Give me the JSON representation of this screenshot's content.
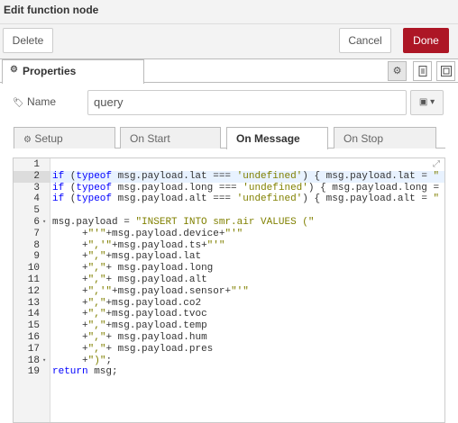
{
  "window": {
    "title": "Edit function node"
  },
  "toolbar": {
    "delete_label": "Delete",
    "cancel_label": "Cancel",
    "done_label": "Done",
    "done_color": "#ad1625"
  },
  "tabs": {
    "properties_label": "Properties"
  },
  "form": {
    "name_label": "Name",
    "name_value": "query"
  },
  "subtabs": [
    {
      "label": "Setup",
      "icon": "gear-icon"
    },
    {
      "label": "On Start"
    },
    {
      "label": "On Message",
      "active": true
    },
    {
      "label": "On Stop"
    }
  ],
  "editor": {
    "current_line": 1,
    "lines": [
      {
        "n": "1",
        "fold": false,
        "tokens": []
      },
      {
        "n": "2",
        "fold": false,
        "tokens": [
          [
            "kw",
            "if"
          ],
          [
            "plain",
            " ("
          ],
          [
            "kw",
            "typeof"
          ],
          [
            "plain",
            " msg.payload.lat "
          ],
          [
            "op",
            "==="
          ],
          [
            "plain",
            " "
          ],
          [
            "str",
            "'undefined'"
          ],
          [
            "plain",
            ") { msg.payload.lat "
          ],
          [
            "op",
            "="
          ],
          [
            "plain",
            " "
          ],
          [
            "str",
            "\""
          ]
        ]
      },
      {
        "n": "3",
        "fold": false,
        "tokens": [
          [
            "kw",
            "if"
          ],
          [
            "plain",
            " ("
          ],
          [
            "kw",
            "typeof"
          ],
          [
            "plain",
            " msg.payload.long "
          ],
          [
            "op",
            "==="
          ],
          [
            "plain",
            " "
          ],
          [
            "str",
            "'undefined'"
          ],
          [
            "plain",
            ") { msg.payload.long "
          ],
          [
            "op",
            "="
          ]
        ]
      },
      {
        "n": "4",
        "fold": false,
        "tokens": [
          [
            "kw",
            "if"
          ],
          [
            "plain",
            " ("
          ],
          [
            "kw",
            "typeof"
          ],
          [
            "plain",
            " msg.payload.alt "
          ],
          [
            "op",
            "==="
          ],
          [
            "plain",
            " "
          ],
          [
            "str",
            "'undefined'"
          ],
          [
            "plain",
            ") { msg.payload.alt "
          ],
          [
            "op",
            "="
          ],
          [
            "plain",
            " "
          ],
          [
            "str",
            "\""
          ]
        ]
      },
      {
        "n": "5",
        "fold": false,
        "tokens": []
      },
      {
        "n": "6",
        "fold": true,
        "tokens": [
          [
            "plain",
            "msg.payload "
          ],
          [
            "op",
            "="
          ],
          [
            "plain",
            " "
          ],
          [
            "str",
            "\"INSERT INTO smr.air VALUES (\""
          ]
        ]
      },
      {
        "n": "7",
        "fold": false,
        "tokens": [
          [
            "plain",
            "     "
          ],
          [
            "op",
            "+"
          ],
          [
            "str",
            "\"'\""
          ],
          [
            "op",
            "+"
          ],
          [
            "plain",
            "msg.payload.device"
          ],
          [
            "op",
            "+"
          ],
          [
            "str",
            "\"'\""
          ]
        ]
      },
      {
        "n": "8",
        "fold": false,
        "tokens": [
          [
            "plain",
            "     "
          ],
          [
            "op",
            "+"
          ],
          [
            "str",
            "\",'\""
          ],
          [
            "op",
            "+"
          ],
          [
            "plain",
            "msg.payload.ts"
          ],
          [
            "op",
            "+"
          ],
          [
            "str",
            "\"'\""
          ]
        ]
      },
      {
        "n": "9",
        "fold": false,
        "tokens": [
          [
            "plain",
            "     "
          ],
          [
            "op",
            "+"
          ],
          [
            "str",
            "\",\""
          ],
          [
            "op",
            "+"
          ],
          [
            "plain",
            "msg.payload.lat"
          ]
        ]
      },
      {
        "n": "10",
        "fold": false,
        "tokens": [
          [
            "plain",
            "     "
          ],
          [
            "op",
            "+"
          ],
          [
            "str",
            "\",\""
          ],
          [
            "op",
            "+"
          ],
          [
            "plain",
            " msg.payload.long"
          ]
        ]
      },
      {
        "n": "11",
        "fold": false,
        "tokens": [
          [
            "plain",
            "     "
          ],
          [
            "op",
            "+"
          ],
          [
            "str",
            "\",\""
          ],
          [
            "op",
            "+"
          ],
          [
            "plain",
            " msg.payload.alt"
          ]
        ]
      },
      {
        "n": "12",
        "fold": false,
        "tokens": [
          [
            "plain",
            "     "
          ],
          [
            "op",
            "+"
          ],
          [
            "str",
            "\",'\""
          ],
          [
            "op",
            "+"
          ],
          [
            "plain",
            "msg.payload.sensor"
          ],
          [
            "op",
            "+"
          ],
          [
            "str",
            "\"'\""
          ]
        ]
      },
      {
        "n": "13",
        "fold": false,
        "tokens": [
          [
            "plain",
            "     "
          ],
          [
            "op",
            "+"
          ],
          [
            "str",
            "\",\""
          ],
          [
            "op",
            "+"
          ],
          [
            "plain",
            "msg.payload.co2"
          ]
        ]
      },
      {
        "n": "14",
        "fold": false,
        "tokens": [
          [
            "plain",
            "     "
          ],
          [
            "op",
            "+"
          ],
          [
            "str",
            "\",\""
          ],
          [
            "op",
            "+"
          ],
          [
            "plain",
            "msg.payload.tvoc"
          ]
        ]
      },
      {
        "n": "15",
        "fold": false,
        "tokens": [
          [
            "plain",
            "     "
          ],
          [
            "op",
            "+"
          ],
          [
            "str",
            "\",\""
          ],
          [
            "op",
            "+"
          ],
          [
            "plain",
            "msg.payload.temp"
          ]
        ]
      },
      {
        "n": "16",
        "fold": false,
        "tokens": [
          [
            "plain",
            "     "
          ],
          [
            "op",
            "+"
          ],
          [
            "str",
            "\",\""
          ],
          [
            "op",
            "+"
          ],
          [
            "plain",
            " msg.payload.hum"
          ]
        ]
      },
      {
        "n": "17",
        "fold": false,
        "tokens": [
          [
            "plain",
            "     "
          ],
          [
            "op",
            "+"
          ],
          [
            "str",
            "\",\""
          ],
          [
            "op",
            "+"
          ],
          [
            "plain",
            " msg.payload.pres"
          ]
        ]
      },
      {
        "n": "18",
        "fold": true,
        "tokens": [
          [
            "plain",
            "     "
          ],
          [
            "op",
            "+"
          ],
          [
            "str",
            "\")\""
          ],
          [
            "plain",
            ";"
          ]
        ]
      },
      {
        "n": "19",
        "fold": false,
        "tokens": [
          [
            "kw",
            "return"
          ],
          [
            "plain",
            " msg;"
          ]
        ]
      }
    ]
  }
}
